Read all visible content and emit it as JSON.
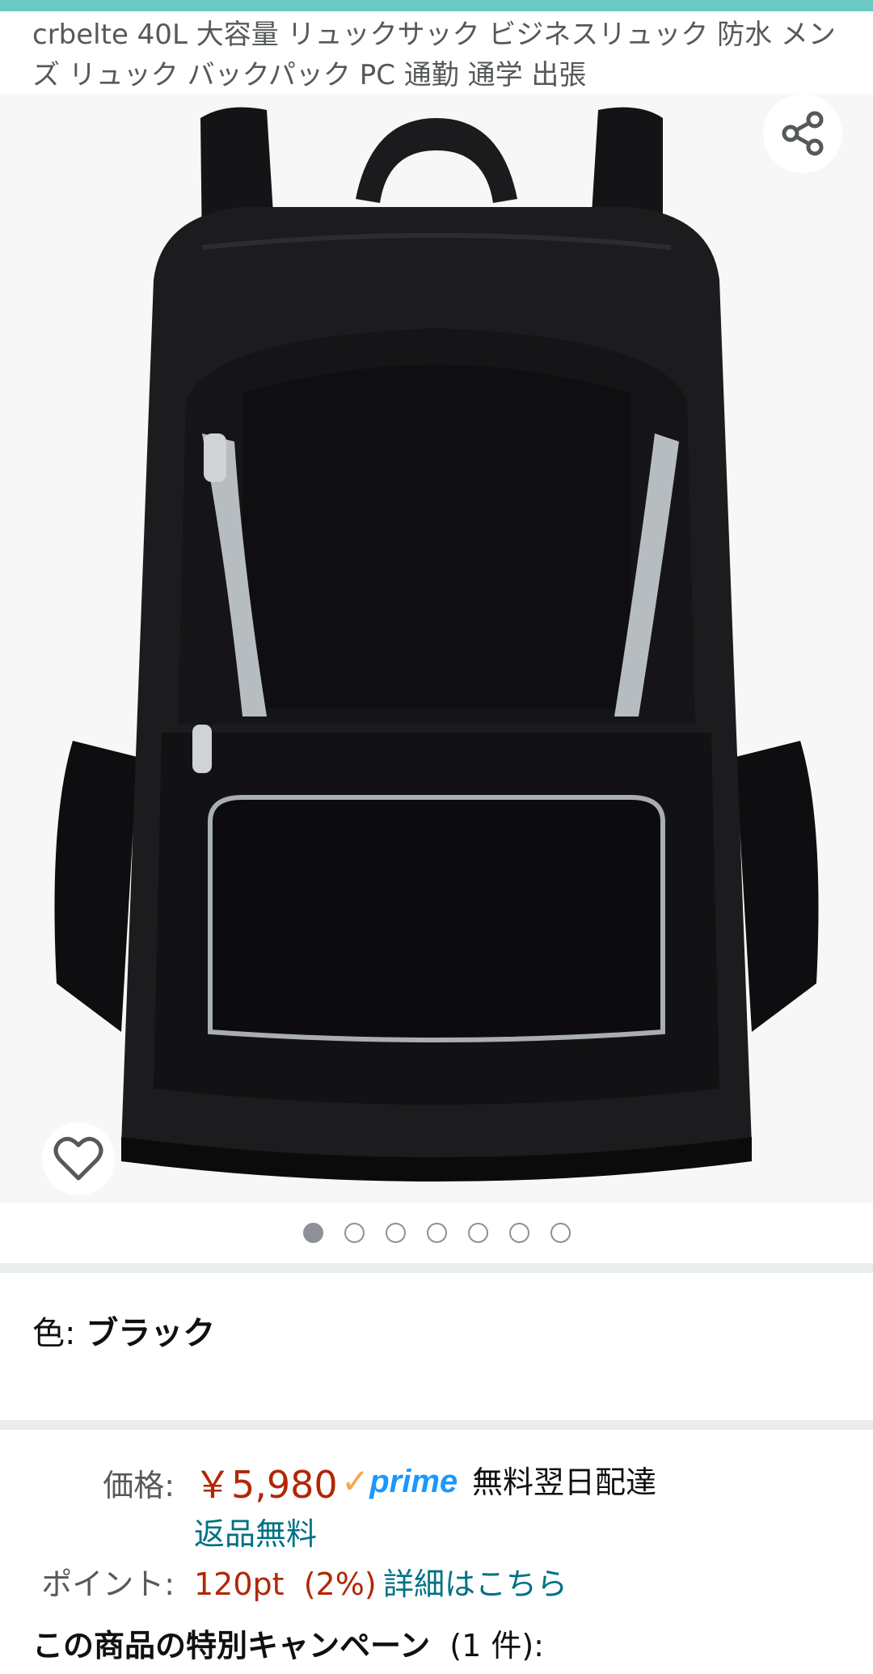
{
  "product": {
    "title": "crbelte 40L 大容量 リュックサック ビジネスリュック 防水 メンズ リュック バックパック PC 通勤 通学 出張"
  },
  "gallery": {
    "image_count": 7,
    "active_index": 0,
    "share_icon": "share-icon",
    "wishlist_icon": "heart-icon"
  },
  "color": {
    "label": "色: ",
    "value": "ブラック"
  },
  "price": {
    "label": "価格:",
    "amount": "￥5,980",
    "prime_check": "✓",
    "prime_label": "prime",
    "shipping": "無料翌日配達",
    "returns": "返品無料"
  },
  "points": {
    "label": "ポイント:",
    "value": "120pt  (2%)",
    "details_link": "詳細はこちら"
  },
  "campaign": {
    "title": "この商品の特別キャンペーン",
    "count": "  (1 件):"
  },
  "colors": {
    "accent": "#6ccac4",
    "price": "#b12704",
    "link": "#007185",
    "prime_blue": "#1a98ff",
    "prime_check": "#f3a847"
  }
}
